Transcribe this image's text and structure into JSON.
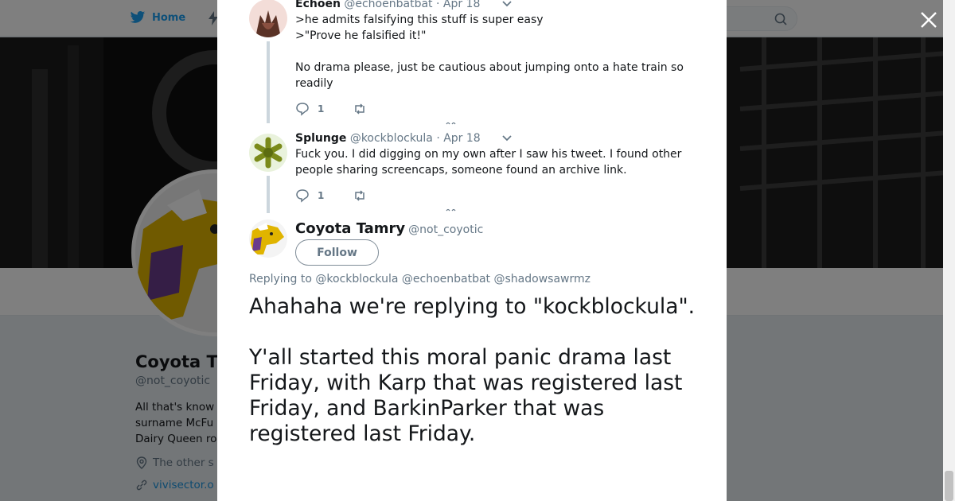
{
  "nav": {
    "home_label": "Home"
  },
  "profile": {
    "name": "Coyota T",
    "handle": "@not_coyotic",
    "bio_lines": [
      "All that's know",
      "surname McFu",
      "Dairy Queen ro"
    ],
    "location": "The other s",
    "url": "vivisector.o"
  },
  "thread": {
    "tweets": [
      {
        "name": "Echoen",
        "handle": "@echoenbatbat",
        "date": "· Apr 18",
        "text": ">he admits falsifying this stuff is super easy\n>\"Prove he falsified it!\"\n\nNo drama please, just be cautious about jumping onto a hate train so readily",
        "reply_count": "1"
      },
      {
        "name": "Splunge",
        "handle": "@kockblockula",
        "date": "· Apr 18",
        "text": "Fuck you. I did digging on my own after I saw his tweet. I found other people sharing screencaps, someone found an archive link.",
        "reply_count": "1"
      }
    ],
    "focus": {
      "name": "Coyota Tamry",
      "handle": "@not_coyotic",
      "follow_label": "Follow",
      "replying_prefix": "Replying to",
      "mentions": [
        "@kockblockula",
        "@echoenbatbat",
        "@shadowsawrmz"
      ],
      "text": "Ahahaha we're replying to \"kockblockula\".\n\nY'all started this moral panic drama last Friday, with Karp that was registered last Friday, and BarkinParker that was registered last Friday."
    }
  },
  "colors": {
    "accent": "#1da1f2",
    "text": "#14171a",
    "muted": "#657786",
    "thread_line": "#ccd6dd"
  },
  "icons": [
    "twitter-bird-icon",
    "search-icon",
    "close-icon",
    "reply-icon",
    "retweet-icon",
    "chevron-down-icon",
    "location-icon",
    "link-icon"
  ]
}
